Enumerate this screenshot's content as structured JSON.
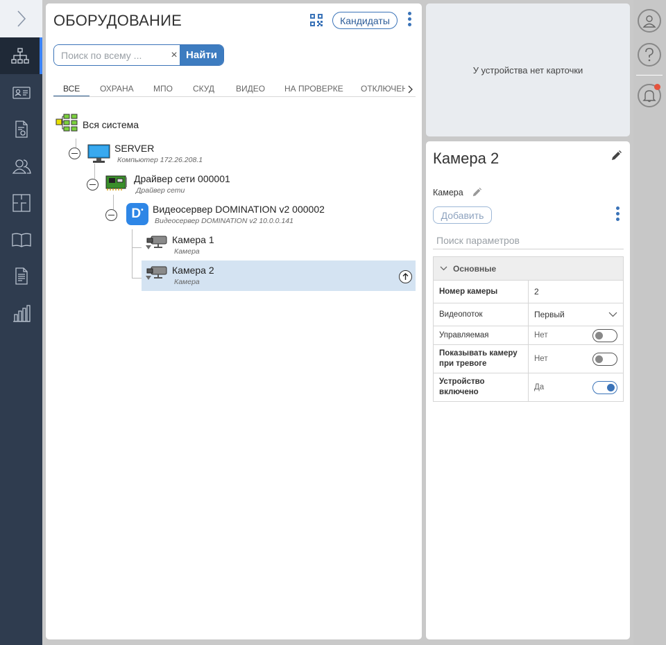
{
  "equipment": {
    "title": "ОБОРУДОВАНИЕ",
    "candidates_label": "Кандидаты",
    "search_placeholder": "Поиск по всему ...",
    "search_button": "Найти",
    "tabs": [
      "ВСЕ",
      "ОХРАНА",
      "МПО",
      "СКУД",
      "ВИДЕО",
      "НА ПРОВЕРКЕ",
      "ОТКЛЮЧЕН"
    ],
    "tree": [
      {
        "name": "Вся система",
        "sub": ""
      },
      {
        "name": "SERVER",
        "sub": "Компьютер   172.26.208.1"
      },
      {
        "name": "Драйвер сети 000001",
        "sub": "Драйвер сети"
      },
      {
        "name": "Видеосервер DOMINATION v2 000002",
        "sub": "Видеосервер DOMINATION v2   10.0.0.141"
      },
      {
        "name": "Камера 1",
        "sub": "Камера"
      },
      {
        "name": "Камера 2",
        "sub": "Камера"
      }
    ]
  },
  "no_card_text": "У устройства нет карточки",
  "details": {
    "title": "Камера 2",
    "type": "Камера",
    "add_button": "Добавить",
    "param_search_placeholder": "Поиск параметров",
    "group": "Основные",
    "rows": [
      {
        "key": "Номер камеры",
        "value": "2"
      },
      {
        "key": "Видеопоток",
        "value": "Первый"
      },
      {
        "key": "Управляемая",
        "value": "Нет",
        "toggle": false
      },
      {
        "key": "Показывать камеру при тревоге",
        "value": "Нет",
        "toggle": false
      },
      {
        "key": "Устройство включено",
        "value": "Да",
        "toggle": true
      }
    ]
  },
  "colors": {
    "accent": "#3d7cc0",
    "nav_bg": "#2f3c4f",
    "selected": "#d4e3f2",
    "notification": "#e5533d"
  },
  "icons": {
    "nav": [
      "chevron-right-icon",
      "structure-icon",
      "id-card-icon",
      "document-badge-icon",
      "users-icon",
      "floorplan-icon",
      "book-icon",
      "report-icon",
      "bar-chart-icon"
    ],
    "rail": [
      "user-icon",
      "help-icon",
      "bell-icon"
    ]
  }
}
